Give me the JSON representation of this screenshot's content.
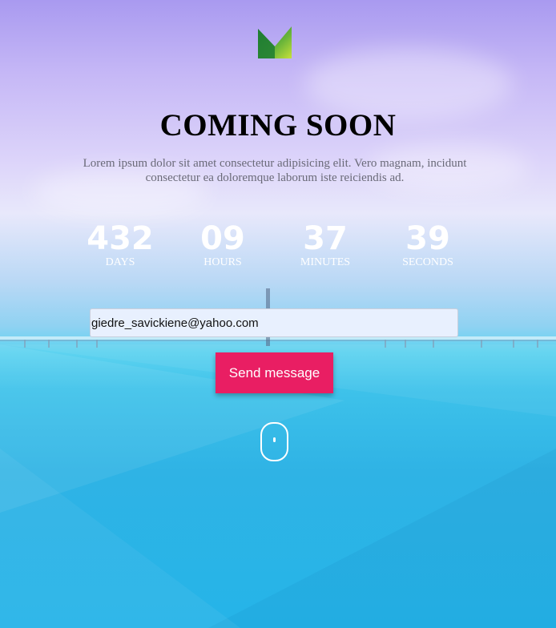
{
  "logo": {
    "icon": "m-logo-icon",
    "colors": [
      "#1e7b2f",
      "#8dc63f",
      "#c6e03a"
    ]
  },
  "hero": {
    "title": "COMING SOON",
    "description": "Lorem ipsum dolor sit amet consectetur adipisicing elit. Vero magnam, incidunt consectetur ea doloremque laborum iste reiciendis ad."
  },
  "countdown": {
    "days": {
      "value": "432",
      "label": "DAYS"
    },
    "hours": {
      "value": "09",
      "label": "HOURS"
    },
    "minutes": {
      "value": "37",
      "label": "MINUTES"
    },
    "seconds": {
      "value": "39",
      "label": "SECONDS"
    }
  },
  "form": {
    "email_value": "giedre_savickiene@yahoo.com",
    "send_label": "Send message"
  },
  "scroll_indicator": {
    "icon": "mouse-scroll-icon"
  },
  "colors": {
    "accent": "#e91e63",
    "text_light": "#ffffff"
  }
}
